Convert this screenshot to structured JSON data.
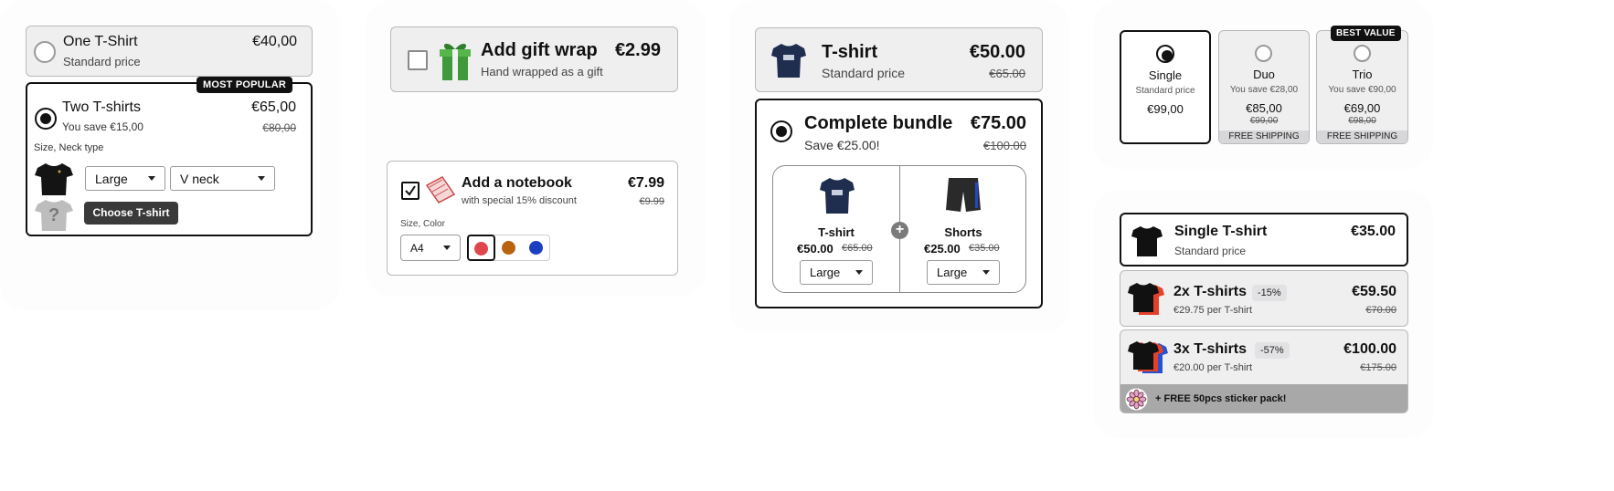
{
  "colors": {
    "accent": "#111111",
    "swatch_red": "#e0474c",
    "swatch_brown": "#b8640f",
    "swatch_blue": "#1a3fc0",
    "sticker_bar": "#a8a8a8"
  },
  "w1": {
    "opt1": {
      "title": "One T-Shirt",
      "subtitle": "Standard price",
      "price": "€40,00"
    },
    "opt2": {
      "badge": "MOST POPULAR",
      "title": "Two T-shirts",
      "subtitle": "You save €15,00",
      "price": "€65,00",
      "old_price": "€80,00",
      "variant_label": "Size, Neck type",
      "size": "Large",
      "neck": "V neck",
      "choose_button": "Choose T-shirt",
      "placeholder_glyph": "?"
    }
  },
  "w2": {
    "giftwrap": {
      "title": "Add gift wrap",
      "subtitle": "Hand wrapped as a gift",
      "price": "€2.99"
    },
    "notebook": {
      "title": "Add a notebook",
      "subtitle": "with special 15% discount",
      "price": "€7.99",
      "old_price": "€9.99",
      "variant_label": "Size, Color",
      "size": "A4"
    }
  },
  "w3": {
    "tshirt": {
      "title": "T-shirt",
      "subtitle": "Standard price",
      "price": "€50.00",
      "old_price": "€65.00"
    },
    "bundle": {
      "title": "Complete bundle",
      "subtitle": "Save €25.00!",
      "price": "€75.00",
      "old_price": "€100.00",
      "items": [
        {
          "name": "T-shirt",
          "price": "€50.00",
          "old_price": "€65.00",
          "size": "Large"
        },
        {
          "name": "Shorts",
          "price": "€25.00",
          "old_price": "€35.00",
          "size": "Large"
        }
      ],
      "plus": "+"
    }
  },
  "w4": {
    "badge": "BEST VALUE",
    "options": [
      {
        "title": "Single",
        "subtitle": "Standard price",
        "price": "€99,00"
      },
      {
        "title": "Duo",
        "subtitle": "You save €28,00",
        "price": "€85,00",
        "old_price": "€99,00",
        "shipping": "FREE SHIPPING"
      },
      {
        "title": "Trio",
        "subtitle": "You save €90,00",
        "price": "€69,00",
        "old_price": "€98,00",
        "shipping": "FREE SHIPPING"
      }
    ]
  },
  "w5": {
    "opt1": {
      "title": "Single T-shirt",
      "subtitle": "Standard price",
      "price": "€35.00"
    },
    "opt2": {
      "title": "2x T-shirts",
      "discount": "-15%",
      "subtitle": "€29.75 per T-shirt",
      "price": "€59.50",
      "old_price": "€70.00"
    },
    "opt3": {
      "title": "3x T-shirts",
      "discount": "-57%",
      "subtitle": "€20.00 per T-shirt",
      "price": "€100.00",
      "old_price": "€175.00"
    },
    "sticker": "+ FREE 50pcs sticker pack!"
  }
}
